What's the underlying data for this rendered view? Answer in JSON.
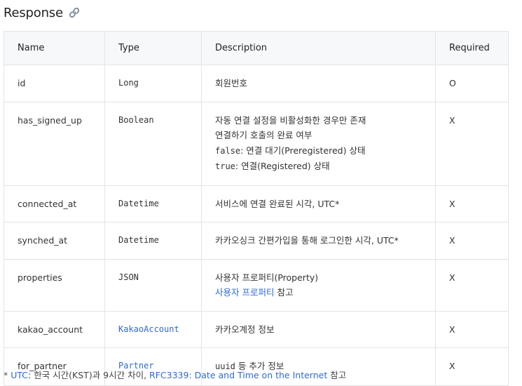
{
  "heading": {
    "title": "Response",
    "icon": "link-icon"
  },
  "table": {
    "columns": [
      "Name",
      "Type",
      "Description",
      "Required"
    ],
    "rows": [
      {
        "name": "id",
        "type": "Long",
        "description": [
          "회원번호"
        ],
        "required": "O"
      },
      {
        "name": "has_signed_up",
        "type": "Boolean",
        "description": [
          "자동 연결 설정을 비활성화한 경우만 존재",
          "연결하기 호출의 완료 여부",
          {
            "code": "false",
            "text": ": 연결 대기(Preregistered) 상태"
          },
          {
            "code": "true",
            "text": ": 연결(Registered) 상태"
          }
        ],
        "required": "X"
      },
      {
        "name": "connected_at",
        "type": "Datetime",
        "description": [
          "서비스에 연결 완료된 시각, UTC*"
        ],
        "required": "X"
      },
      {
        "name": "synched_at",
        "type": "Datetime",
        "description": [
          "카카오싱크 간편가입을 통해 로그인한 시각, UTC*"
        ],
        "required": "X"
      },
      {
        "name": "properties",
        "type": "JSON",
        "description": [
          "사용자 프로퍼티(Property)",
          {
            "link": "사용자 프로퍼티",
            "text": " 참고"
          }
        ],
        "required": "X"
      },
      {
        "name": "kakao_account",
        "type": "KakaoAccount",
        "type_is_link": true,
        "description": [
          "카카오계정 정보"
        ],
        "required": "X"
      },
      {
        "name": "for_partner",
        "type": "Partner",
        "type_is_link": true,
        "description": [
          {
            "code": "uuid",
            "text": " 등 추가 정보"
          }
        ],
        "required": "X"
      }
    ]
  },
  "footnote": {
    "star": "* ",
    "utc_link": "UTC",
    "text_1": ": 한국 시간(KST)과 9시간 차이, ",
    "rfc_link": "RFC3339: Date and Time on the Internet",
    "text_2": " 참고"
  },
  "colors": {
    "link": "#2f6ad8",
    "header_bg": "#f7f8f9",
    "border": "#e4e4e4"
  }
}
